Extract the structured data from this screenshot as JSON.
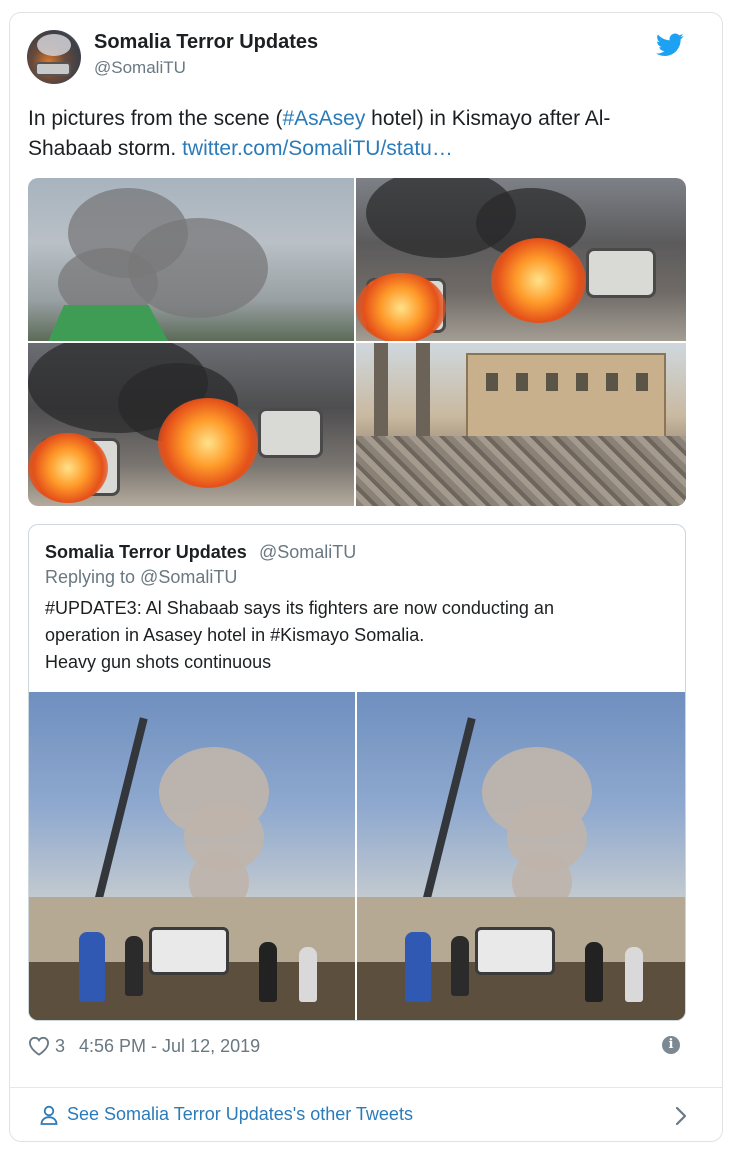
{
  "tweet": {
    "author_name": "Somalia Terror Updates",
    "author_handle": "@SomaliTU",
    "text_before": "In pictures from the scene (",
    "hashtag": "#AsAsey",
    "text_after": " hotel) in Kismayo after Al-Shabaab storm. ",
    "link": "twitter.com/SomaliTU/statu…",
    "images": [
      "smoke-over-building",
      "burning-cars",
      "burning-cars-closeup",
      "damaged-hotel-street"
    ]
  },
  "quoted_tweet": {
    "author_name": "Somalia Terror Updates",
    "author_handle": "@SomaliTU",
    "replying_to": "Replying to @SomaliTU",
    "lines": [
      "#UPDATE3: Al Shabaab says its fighters are now conducting an",
      "operation in Asasey hotel in #Kismayo Somalia.",
      "Heavy gun shots continuous"
    ],
    "images": [
      "explosion-smoke-left",
      "explosion-smoke-right"
    ]
  },
  "meta": {
    "like_count": "3",
    "timestamp": "4:56 PM - Jul 12, 2019",
    "info_symbol": "i"
  },
  "footer": {
    "link_text": "See Somalia Terror Updates's other Tweets"
  },
  "colors": {
    "link": "#2b7bb9",
    "twitter_blue": "#1da1f2",
    "muted_text": "#697882",
    "border": "#dfe3e6"
  },
  "icons": [
    "twitter-bird-icon",
    "heart-icon",
    "info-icon",
    "person-icon",
    "chevron-right-icon"
  ]
}
